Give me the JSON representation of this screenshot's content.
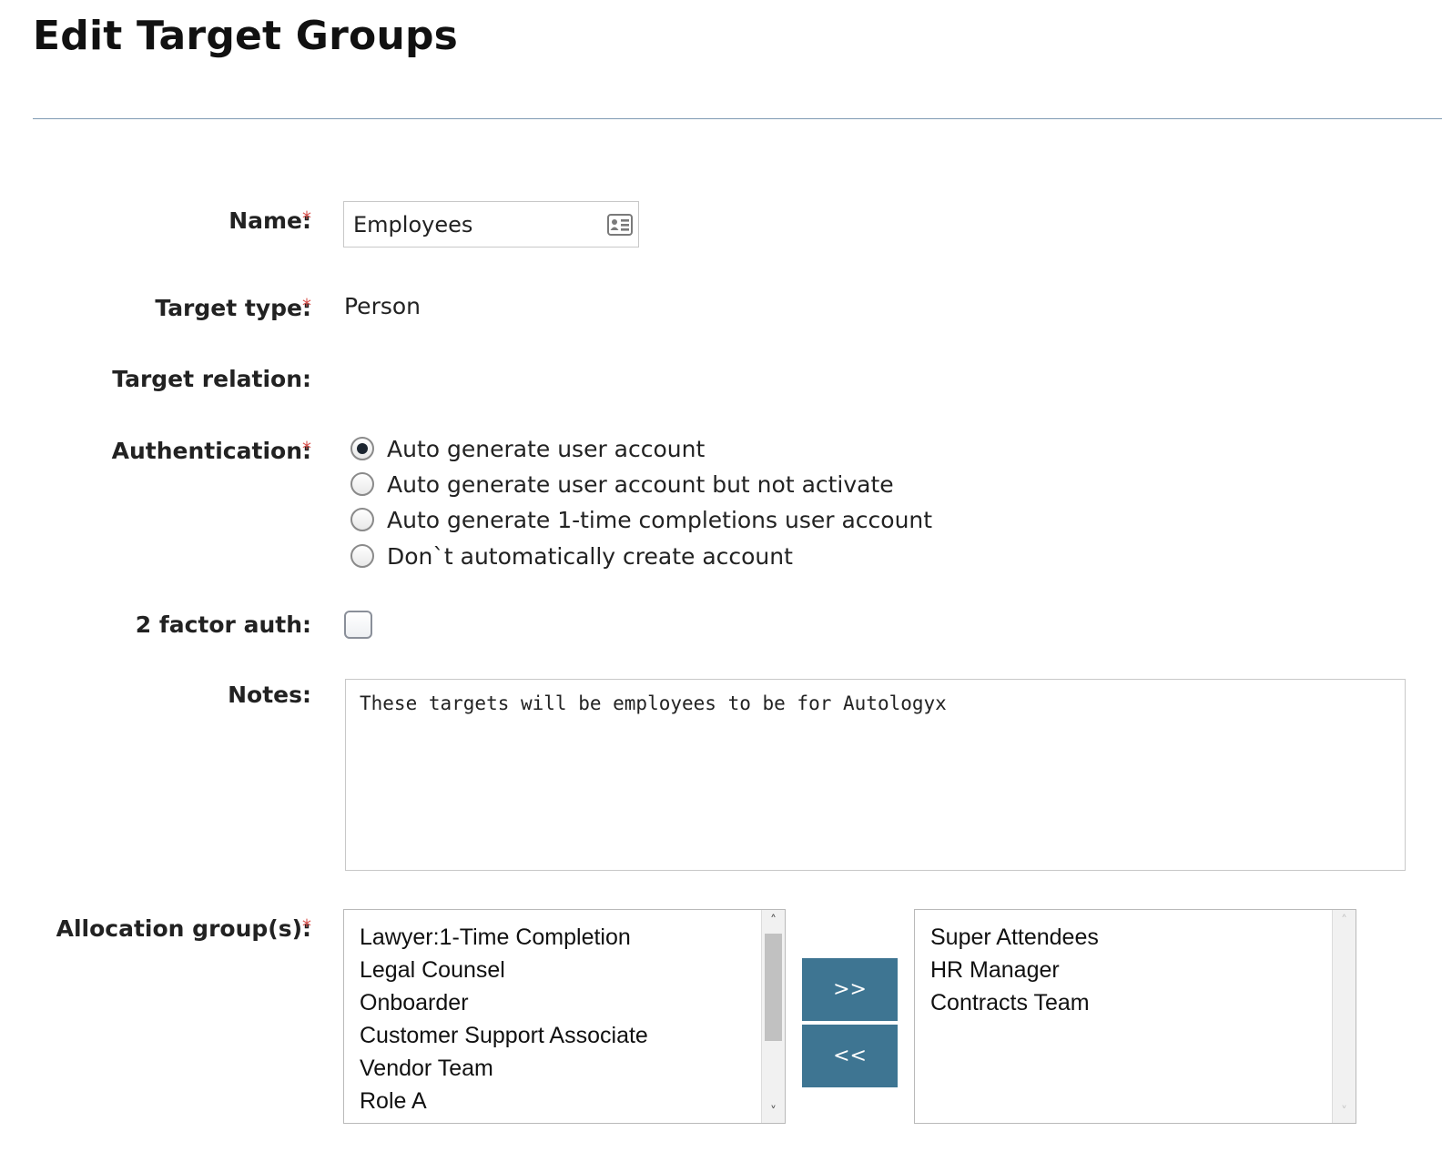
{
  "page": {
    "title": "Edit Target Groups"
  },
  "form": {
    "name": {
      "label": "Name:",
      "required": "*",
      "value": "Employees",
      "icon": "contact-card-icon"
    },
    "target_type": {
      "label": "Target type:",
      "required": "*",
      "value": "Person"
    },
    "target_relation": {
      "label": "Target relation:"
    },
    "authentication": {
      "label": "Authentication:",
      "required": "*",
      "options": [
        {
          "label": "Auto generate user account",
          "checked": true
        },
        {
          "label": "Auto generate user account but not activate",
          "checked": false
        },
        {
          "label": "Auto generate 1-time completions user account",
          "checked": false
        },
        {
          "label": "Don`t automatically create account",
          "checked": false
        }
      ]
    },
    "two_factor": {
      "label": "2 factor auth:",
      "checked": false
    },
    "notes": {
      "label": "Notes:",
      "value": "These targets will be employees to be for Autologyx"
    },
    "allocation": {
      "label": "Allocation group(s):",
      "required": "*",
      "available": [
        "Lawyer:1-Time Completion",
        "Legal Counsel",
        "Onboarder",
        "Customer Support Associate",
        "Vendor Team",
        "Role A"
      ],
      "selected": [
        "Super Attendees",
        "HR Manager",
        "Contracts Team"
      ],
      "add_label": ">>",
      "remove_label": "<<"
    }
  },
  "colors": {
    "button": "#3e7592",
    "required": "#d9534f",
    "divider": "#7f9ab3"
  }
}
